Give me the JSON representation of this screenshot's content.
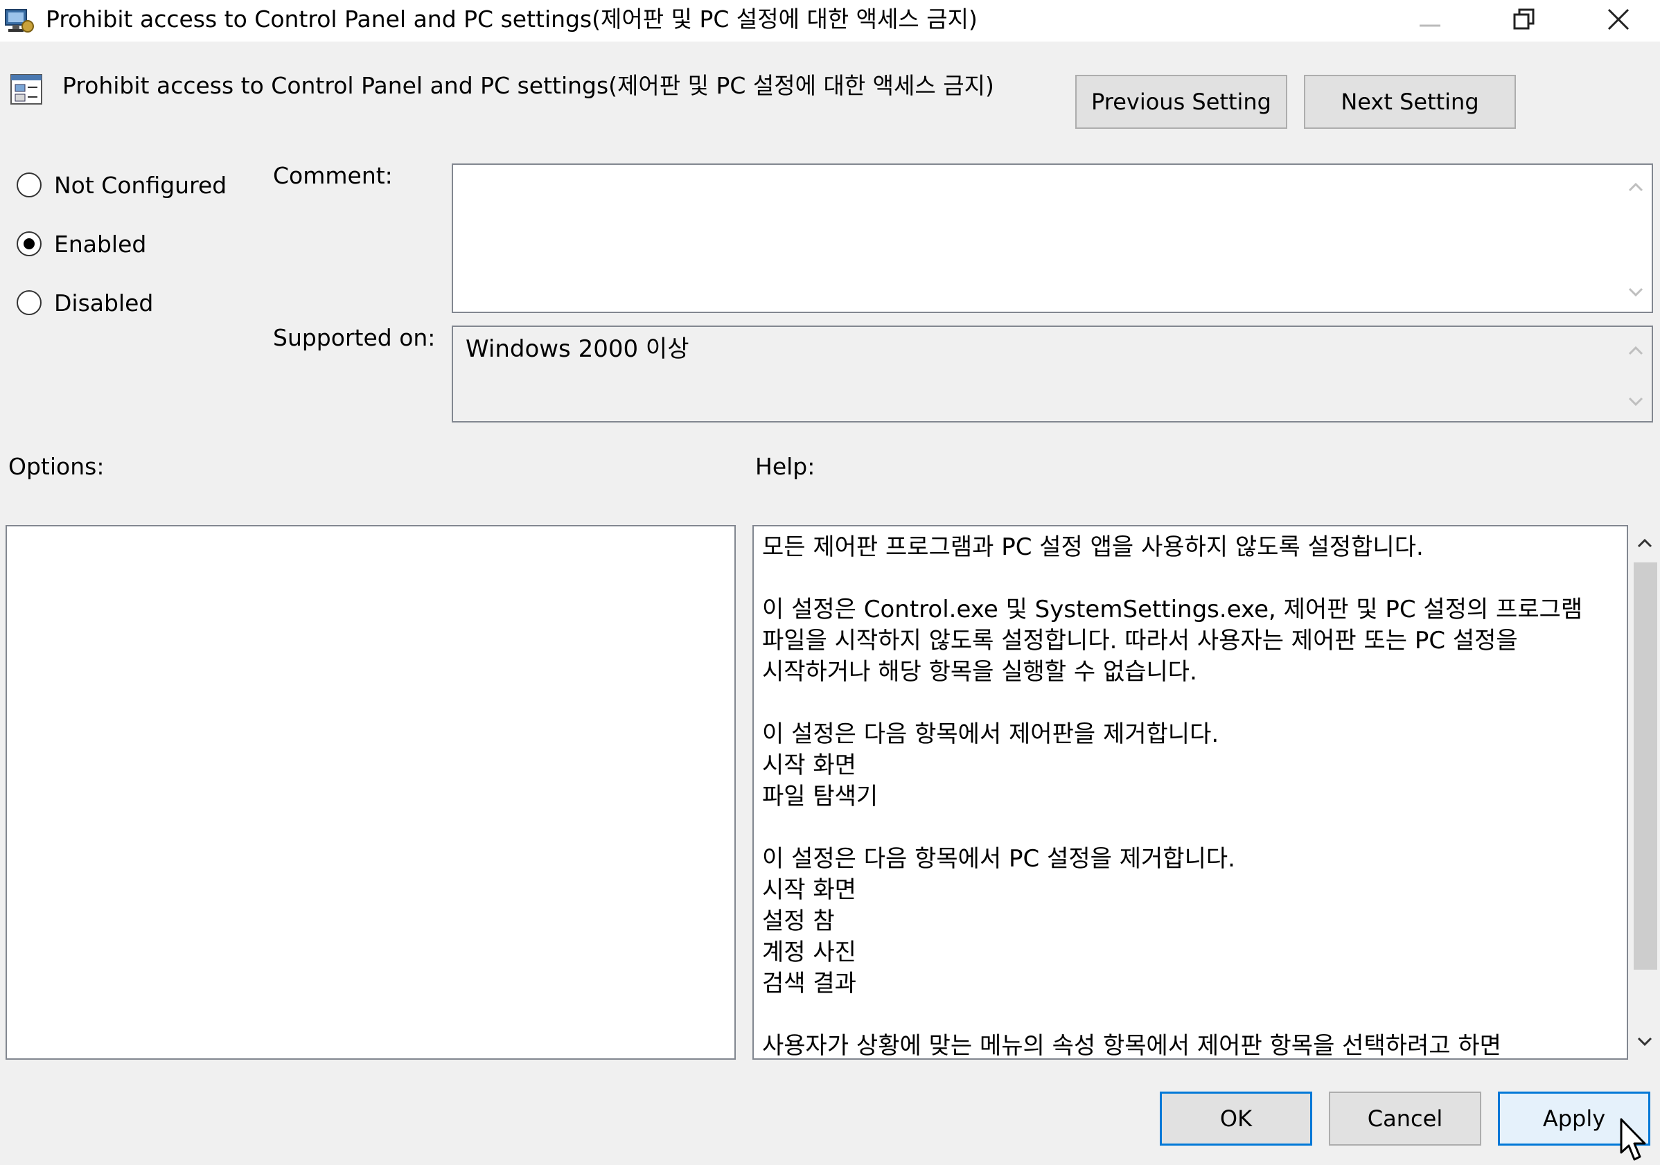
{
  "window": {
    "title": "Prohibit access to Control Panel and PC settings(제어판 및 PC 설정에 대한 액세스 금지)"
  },
  "header": {
    "policy_name": "Prohibit access to Control Panel and PC settings(제어판 및 PC 설정에 대한 액세스 금지)",
    "previous_label": "Previous Setting",
    "next_label": "Next Setting"
  },
  "state": {
    "options": [
      {
        "label": "Not Configured",
        "checked": false
      },
      {
        "label": "Enabled",
        "checked": true
      },
      {
        "label": "Disabled",
        "checked": false
      }
    ]
  },
  "comment": {
    "label": "Comment:",
    "value": ""
  },
  "supported": {
    "label": "Supported on:",
    "value": "Windows 2000 이상"
  },
  "options_panel": {
    "label": "Options:"
  },
  "help_panel": {
    "label": "Help:",
    "text": "모든 제어판 프로그램과 PC 설정 앱을 사용하지 않도록 설정합니다.\n\n이 설정은 Control.exe 및 SystemSettings.exe, 제어판 및 PC 설정의 프로그램 파일을 시작하지 않도록 설정합니다. 따라서 사용자는 제어판 또는 PC 설정을 시작하거나 해당 항목을 실행할 수 없습니다.\n\n이 설정은 다음 항목에서 제어판을 제거합니다.\n시작 화면\n파일 탐색기\n\n이 설정은 다음 항목에서 PC 설정을 제거합니다.\n시작 화면\n설정 참\n계정 사진\n검색 결과\n\n사용자가 상황에 맞는 메뉴의 속성 항목에서 제어판 항목을 선택하려고 하면"
  },
  "footer": {
    "ok_label": "OK",
    "cancel_label": "Cancel",
    "apply_label": "Apply"
  },
  "colors": {
    "accent": "#0078d7",
    "background": "#f0f0f0"
  }
}
